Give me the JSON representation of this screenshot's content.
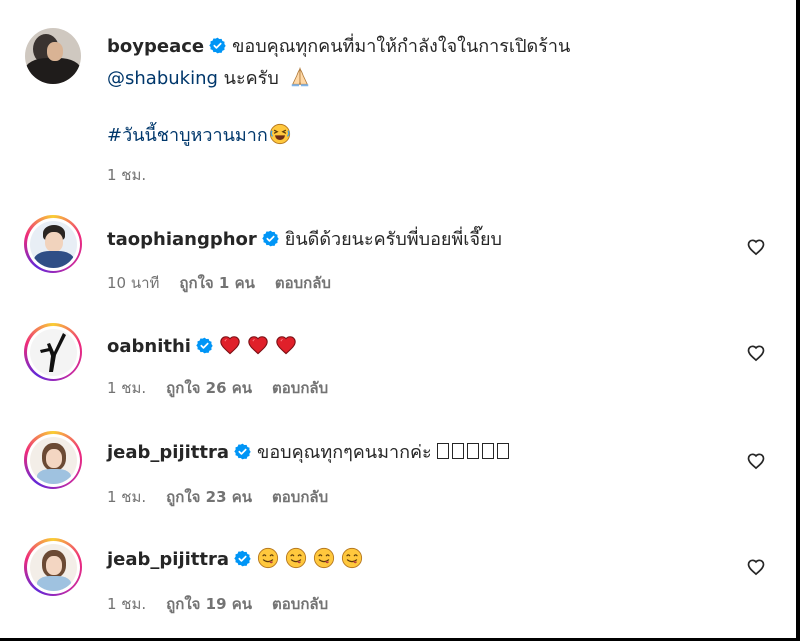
{
  "post": {
    "username": "boypeace",
    "caption_line1": "ขอบคุณทุกคนที่มาให้กำลังใจในการเปิดร้าน",
    "mention": "@shabuking",
    "caption_line2_suffix": "นะครับ",
    "hashtag": "#วันนี้ชาบูหวานมาก",
    "time": "1 ชม."
  },
  "labels": {
    "reply": "ตอบกลับ"
  },
  "comments": [
    {
      "username": "taophiangphor",
      "text": "ยินดีด้วยนะครับพี่บอยพี่เจี๊ยบ",
      "time": "10 นาที",
      "likes": "ถูกใจ 1 คน"
    },
    {
      "username": "oabnithi",
      "text": "",
      "time": "1 ชม.",
      "likes": "ถูกใจ 26 คน"
    },
    {
      "username": "jeab_pijittra",
      "text": "ขอบคุณทุกๆคนมากค่ะ",
      "time": "1 ชม.",
      "likes": "ถูกใจ 23 คน"
    },
    {
      "username": "jeab_pijittra",
      "text": "",
      "time": "1 ชม.",
      "likes": "ถูกใจ 19 คน"
    }
  ],
  "colors": {
    "verified": "#0095f6",
    "link": "#00376b",
    "meta": "#737373"
  }
}
